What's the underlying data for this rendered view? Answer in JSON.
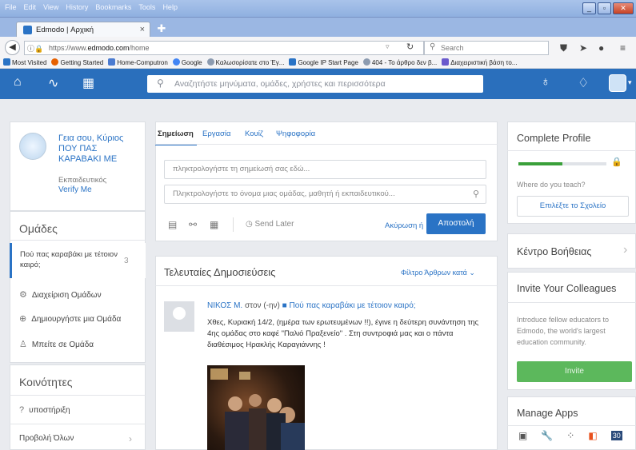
{
  "browser": {
    "menu": [
      "File",
      "Edit",
      "View",
      "History",
      "Bookmarks",
      "Tools",
      "Help"
    ],
    "tab_title": "Edmodo | Αρχική",
    "url_prefix": "https://www.",
    "url_domain": "edmodo.com",
    "url_path": "/home",
    "search_placeholder": "Search",
    "bookmarks": [
      {
        "label": "Most Visited",
        "color": "#2a73c5"
      },
      {
        "label": "Getting Started",
        "color": "#e66000"
      },
      {
        "label": "Home-Computron",
        "color": "#4b7bd0"
      },
      {
        "label": "Google",
        "color": "#4285f4"
      },
      {
        "label": "Καλωσορίσατε στο Έγ...",
        "color": "#8c9bb0"
      },
      {
        "label": "Google IP Start Page",
        "color": "#2a73c5"
      },
      {
        "label": "404 - Το άρθρο δεν β...",
        "color": "#8c9bb0"
      },
      {
        "label": "Διαχειριστική βάση το...",
        "color": "#6a5acd"
      }
    ]
  },
  "app": {
    "search_placeholder": "Αναζητήστε μηνύματα, ομάδες, χρήστες και περισσότερα",
    "profile": {
      "greeting": "Γεια σου, Κύριος ΠΟΥ ΠΑΣ ΚΑΡΑΒΑΚΙ ΜΕ",
      "role": "Εκπαιδευτικός",
      "verify": "Verify Me"
    },
    "groups": {
      "title": "Ομάδες",
      "active_group": "Πού πας καραβάκι με τέτοιον καιρό;",
      "active_count": "3",
      "manage": "Διαχείριση Ομάδων",
      "create": "Δημιουργήστε μια Ομάδα",
      "join": "Μπείτε σε Ομάδα"
    },
    "communities": {
      "title": "Κοινότητες",
      "support": "υποστήριξη",
      "view_all": "Προβολή Όλων"
    },
    "composer": {
      "tabs": [
        "Σημείωση",
        "Εργασία",
        "Κουίζ",
        "Ψηφοφορία"
      ],
      "note_placeholder": "πληκτρολογήστε τη σημείωσή σας εδώ...",
      "to_placeholder": "Πληκτρολογήστε το όνομα μιας ομάδας, μαθητή ή εκπαιδευτικού...",
      "send_later": "Send Later",
      "cancel": "Ακύρωση ή",
      "send": "Αποστολή"
    },
    "feed": {
      "title": "Τελευταίες Δημοσιεύσεις",
      "filter": "Φίλτρο Άρθρων κατά",
      "post": {
        "author": "ΝΙΚΟΣ Μ.",
        "meta": "στον (-ην)",
        "group": "Πού πας καραβάκι με τέτοιον καιρό;",
        "text": "Χθες, Κυριακή 14/2, (ημέρα των ερωτευμένων !!), έγινε η δεύτερη συνάντηση της 4ης ομάδας στο καφέ \"Παλιό Πραξενείο\" . Στη συντροφιά μας και ο πάντα διαθέσιμος Ηρακλής Καραγιάννης !"
      }
    },
    "right": {
      "complete_profile": "Complete Profile",
      "profile_progress": 0.5,
      "teach_question": "Where do you teach?",
      "choose_school": "Επιλέξτε το Σχολείο",
      "help_center": "Κέντρο Βοήθειας",
      "invite_title": "Invite Your Colleagues",
      "invite_text": "Introduce fellow educators to Edmodo, the world's largest education community.",
      "invite_button": "Invite",
      "manage_apps": "Manage Apps"
    }
  }
}
